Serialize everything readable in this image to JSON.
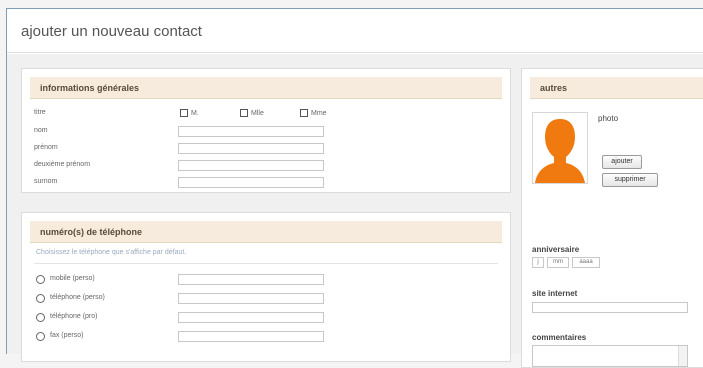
{
  "page": {
    "title": "ajouter un nouveau contact"
  },
  "general": {
    "header": "informations générales",
    "fields": [
      {
        "label": "titre"
      },
      {
        "label": "nom"
      },
      {
        "label": "prénom"
      },
      {
        "label": "deuxième prénom"
      },
      {
        "label": "surnom"
      }
    ],
    "title_options": [
      "M.",
      "Mlle",
      "Mme"
    ]
  },
  "phone": {
    "header": "numéro(s) de téléphone",
    "hint": "Choisissez le téléphone que s'affiche par défaut.",
    "options": [
      "mobile (perso)",
      "téléphone (perso)",
      "téléphone (pro)",
      "fax (perso)"
    ]
  },
  "other": {
    "header": "autres",
    "photo_label": "photo",
    "add_button": "ajouter",
    "delete_button": "supprimer",
    "birthday_label": "anniversaire",
    "birthday_day": "j",
    "birthday_month": "mm",
    "birthday_year": "aaaa",
    "website_label": "site internet",
    "comments_label": "commentaires"
  },
  "colors": {
    "header_bg": "#f6ebdc",
    "avatar": "#f07a10"
  }
}
